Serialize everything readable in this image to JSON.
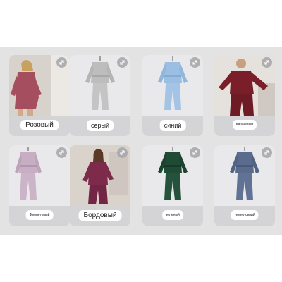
{
  "catalog": {
    "items": [
      {
        "label": "Розовый",
        "color": "#a54e5f",
        "photo": "model-photo",
        "icon": "expand-icon"
      },
      {
        "label": "серый",
        "color": "#bdbdbd",
        "photo": "product-photo",
        "icon": "expand-icon"
      },
      {
        "label": "синий",
        "color": "#9bbfe2",
        "photo": "product-photo",
        "icon": "expand-icon"
      },
      {
        "label": "вишневый",
        "color": "#7a1f2a",
        "photo": "model-photo",
        "icon": "expand-icon"
      },
      {
        "label": "Фиолетовый",
        "color": "#c7aec3",
        "photo": "product-photo",
        "icon": "expand-icon"
      },
      {
        "label": "Бордовый",
        "color": "#7d2a4b",
        "photo": "model-photo",
        "icon": "expand-icon"
      },
      {
        "label": "зеленый",
        "color": "#1f4a33",
        "photo": "product-photo",
        "icon": "expand-icon"
      },
      {
        "label": "темно-синий",
        "color": "#5a6b8d",
        "photo": "product-photo",
        "icon": "expand-icon"
      }
    ]
  }
}
